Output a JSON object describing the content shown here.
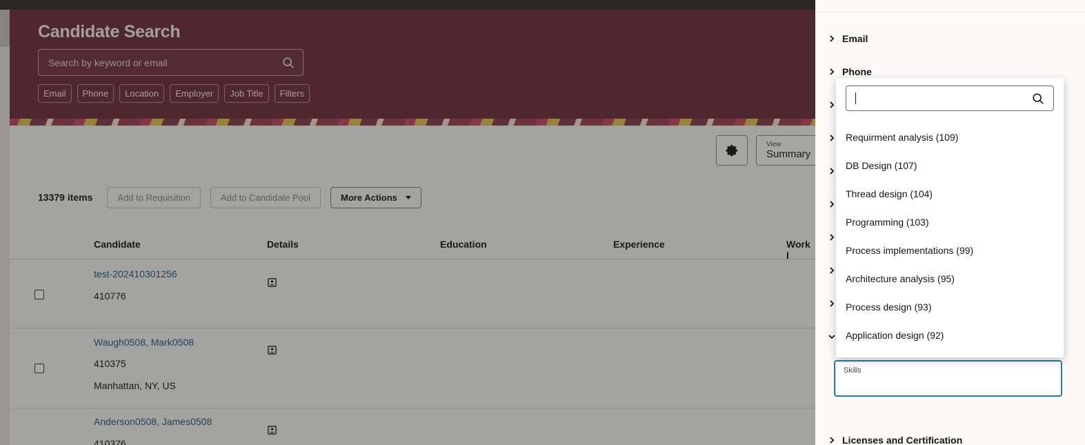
{
  "page": {
    "title": "Candidate Search",
    "search_placeholder": "Search by keyword or email",
    "filter_chips": [
      "Email",
      "Phone",
      "Location",
      "Employer",
      "Job Title",
      "Filters"
    ]
  },
  "toolbar": {
    "view_label": "View",
    "view_value": "Summary"
  },
  "actions": {
    "items_count": "13379 items",
    "add_to_requisition": "Add to Requisition",
    "add_to_candidate_pool": "Add to Candidate Pool",
    "more_actions": "More Actions"
  },
  "table": {
    "columns": [
      "Candidate",
      "Details",
      "Education",
      "Experience",
      "Work I"
    ],
    "rows": [
      {
        "name": "test-202410301256",
        "id": "410776",
        "location": ""
      },
      {
        "name": "Waugh0508, Mark0508",
        "id": "410375",
        "location": "Manhattan, NY, US"
      },
      {
        "name": "Anderson0508, James0508",
        "id": "410376",
        "location": ""
      }
    ]
  },
  "drawer": {
    "sections": [
      "Email",
      "Phone",
      "Licenses and Certification"
    ],
    "skills_label": "Skills",
    "popup": {
      "search_value": "",
      "options": [
        "Requirment analysis (109)",
        "DB Design (107)",
        "Thread design (104)",
        "Programming (103)",
        "Process implementations (99)",
        "Architecture analysis (95)",
        "Process design (93)",
        "Application design (92)"
      ]
    }
  }
}
